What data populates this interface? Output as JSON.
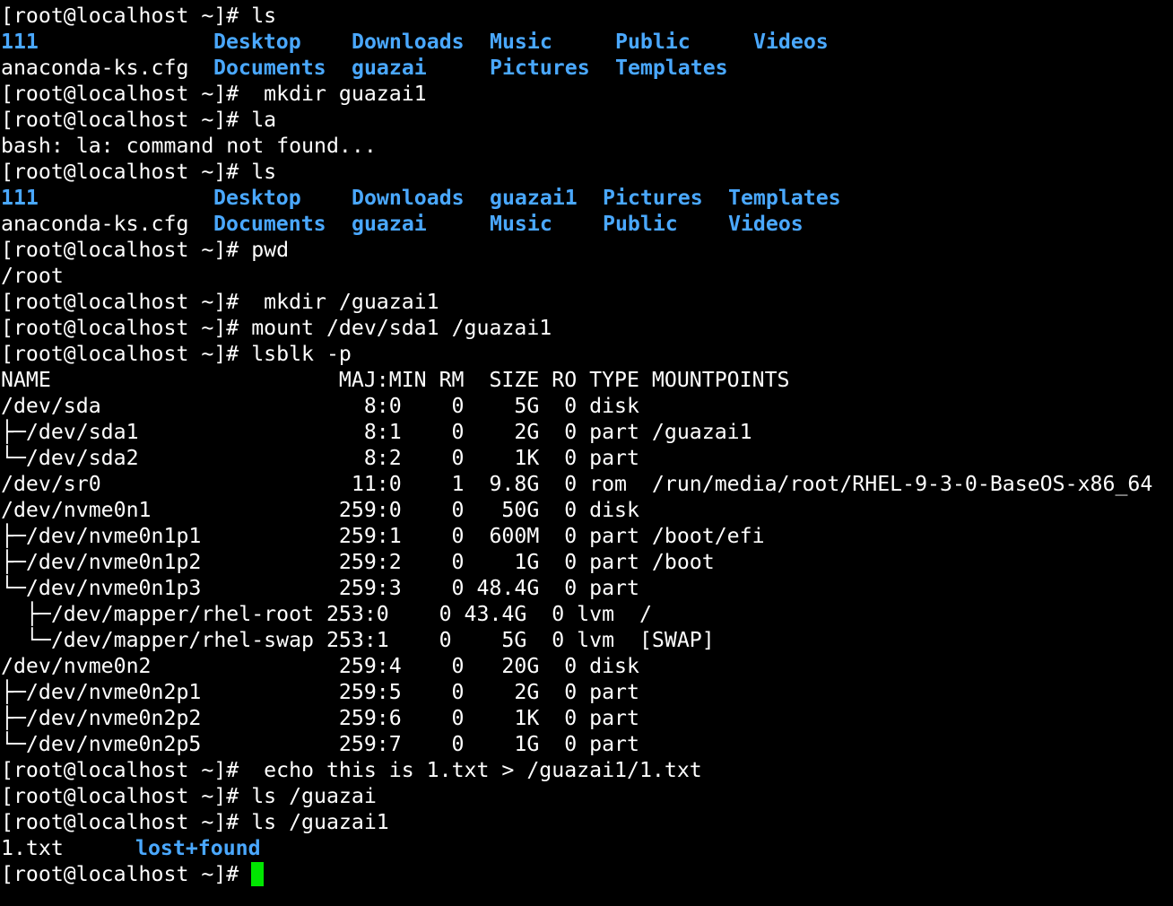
{
  "colors": {
    "background": "#000000",
    "text": "#ffffff",
    "directory": "#4aa8ff",
    "cursor": "#00e600"
  },
  "prompt": "[root@localhost ~]# ",
  "lines": [
    {
      "type": "cmd",
      "text": "ls"
    },
    {
      "type": "cols",
      "cells": [
        {
          "text": "111",
          "dir": true
        },
        {
          "text": "Desktop",
          "dir": true
        },
        {
          "text": "Downloads",
          "dir": true
        },
        {
          "text": "Music",
          "dir": true
        },
        {
          "text": "Public",
          "dir": true
        },
        {
          "text": "Videos",
          "dir": true
        }
      ]
    },
    {
      "type": "cols",
      "cells": [
        {
          "text": "anaconda-ks.cfg",
          "dir": false
        },
        {
          "text": "Documents",
          "dir": true
        },
        {
          "text": "guazai",
          "dir": true
        },
        {
          "text": "Pictures",
          "dir": true
        },
        {
          "text": "Templates",
          "dir": true
        }
      ]
    },
    {
      "type": "cmd",
      "text": " mkdir guazai1"
    },
    {
      "type": "cmd",
      "text": "la"
    },
    {
      "type": "out",
      "text": "bash: la: command not found..."
    },
    {
      "type": "cmd",
      "text": "ls"
    },
    {
      "type": "cols",
      "cells": [
        {
          "text": "111",
          "dir": true
        },
        {
          "text": "Desktop",
          "dir": true
        },
        {
          "text": "Downloads",
          "dir": true
        },
        {
          "text": "guazai1",
          "dir": true
        },
        {
          "text": "Pictures",
          "dir": true
        },
        {
          "text": "Templates",
          "dir": true
        }
      ]
    },
    {
      "type": "cols",
      "cells": [
        {
          "text": "anaconda-ks.cfg",
          "dir": false
        },
        {
          "text": "Documents",
          "dir": true
        },
        {
          "text": "guazai",
          "dir": true
        },
        {
          "text": "Music",
          "dir": true
        },
        {
          "text": "Public",
          "dir": true
        },
        {
          "text": "Videos",
          "dir": true
        }
      ]
    },
    {
      "type": "cmd",
      "text": "pwd"
    },
    {
      "type": "out",
      "text": "/root"
    },
    {
      "type": "cmd",
      "text": " mkdir /guazai1"
    },
    {
      "type": "cmd",
      "text": "mount /dev/sda1 /guazai1"
    },
    {
      "type": "cmd",
      "text": "lsblk -p"
    },
    {
      "type": "out",
      "text": "NAME                       MAJ:MIN RM  SIZE RO TYPE MOUNTPOINTS"
    },
    {
      "type": "out",
      "text": "/dev/sda                     8:0    0    5G  0 disk "
    },
    {
      "type": "out",
      "text": "├─/dev/sda1                  8:1    0    2G  0 part /guazai1"
    },
    {
      "type": "out",
      "text": "└─/dev/sda2                  8:2    0    1K  0 part "
    },
    {
      "type": "out",
      "text": "/dev/sr0                    11:0    1  9.8G  0 rom  /run/media/root/RHEL-9-3-0-BaseOS-x86_64"
    },
    {
      "type": "out",
      "text": "/dev/nvme0n1               259:0    0   50G  0 disk "
    },
    {
      "type": "out",
      "text": "├─/dev/nvme0n1p1           259:1    0  600M  0 part /boot/efi"
    },
    {
      "type": "out",
      "text": "├─/dev/nvme0n1p2           259:2    0    1G  0 part /boot"
    },
    {
      "type": "out",
      "text": "└─/dev/nvme0n1p3           259:3    0 48.4G  0 part "
    },
    {
      "type": "out",
      "text": "  ├─/dev/mapper/rhel-root 253:0    0 43.4G  0 lvm  /"
    },
    {
      "type": "out",
      "text": "  └─/dev/mapper/rhel-swap 253:1    0    5G  0 lvm  [SWAP]"
    },
    {
      "type": "out",
      "text": "/dev/nvme0n2               259:4    0   20G  0 disk "
    },
    {
      "type": "out",
      "text": "├─/dev/nvme0n2p1           259:5    0    2G  0 part "
    },
    {
      "type": "out",
      "text": "├─/dev/nvme0n2p2           259:6    0    1K  0 part "
    },
    {
      "type": "out",
      "text": "└─/dev/nvme0n2p5           259:7    0    1G  0 part "
    },
    {
      "type": "cmd",
      "text": " echo this is 1.txt > /guazai1/1.txt"
    },
    {
      "type": "cmd",
      "text": "ls /guazai"
    },
    {
      "type": "cmd",
      "text": "ls /guazai1"
    },
    {
      "type": "cols",
      "cells": [
        {
          "text": "1.txt",
          "dir": false
        },
        {
          "text": "lost+found",
          "dir": true
        }
      ]
    },
    {
      "type": "cursor",
      "text": ""
    }
  ]
}
